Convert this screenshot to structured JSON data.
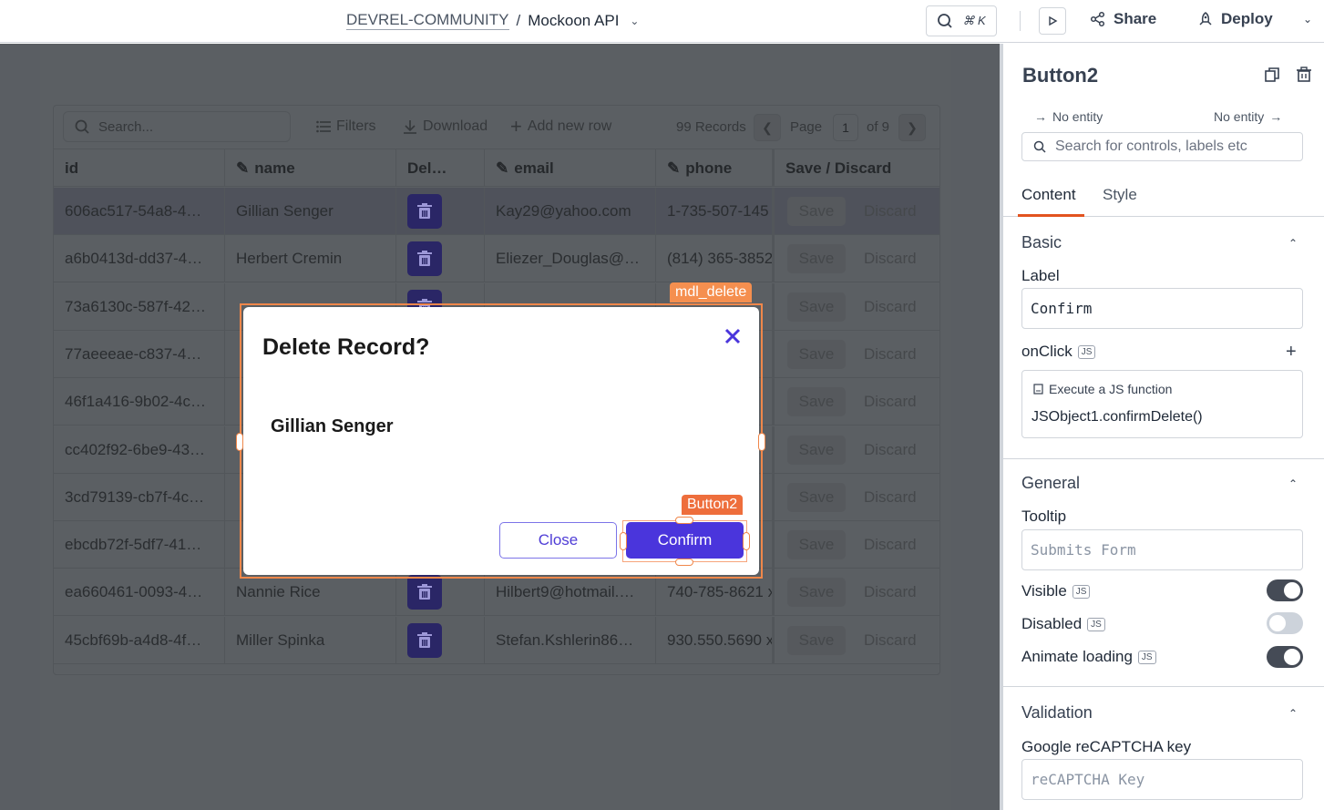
{
  "header": {
    "workspace": "DEVREL-COMMUNITY",
    "separator": "/",
    "app_name": "Mockoon API",
    "cmdk_shortcut": "⌘ K",
    "share_label": "Share",
    "deploy_label": "Deploy"
  },
  "table": {
    "search_placeholder": "Search...",
    "filters_label": "Filters",
    "download_label": "Download",
    "add_row_label": "Add new row",
    "records": "99 Records",
    "page_label": "Page",
    "page_current": "1",
    "page_of": "of 9",
    "columns": [
      "id",
      "name",
      "Del…",
      "email",
      "phone",
      "Save / Discard"
    ],
    "save_label": "Save",
    "discard_label": "Discard",
    "rows": [
      {
        "id": "606ac517-54a8-4…",
        "name": "Gillian Senger",
        "email": "Kay29@yahoo.com",
        "phone": "1-735-507-145",
        "selected": true
      },
      {
        "id": "a6b0413d-dd37-4…",
        "name": "Herbert Cremin",
        "email": "Eliezer_Douglas@…",
        "phone": "(814) 365-3852"
      },
      {
        "id": "73a6130c-587f-42…",
        "name": "",
        "email": "",
        "phone": ""
      },
      {
        "id": "77aeeeae-c837-4…",
        "name": "",
        "email": "",
        "phone": ""
      },
      {
        "id": "46f1a416-9b02-4c…",
        "name": "",
        "email": "",
        "phone": ""
      },
      {
        "id": "cc402f92-6be9-43…",
        "name": "",
        "email": "",
        "phone": ""
      },
      {
        "id": "3cd79139-cb7f-4c…",
        "name": "",
        "email": "",
        "phone": ""
      },
      {
        "id": "ebcdb72f-5df7-41…",
        "name": "",
        "email": "",
        "phone": ""
      },
      {
        "id": "ea660461-0093-4…",
        "name": "Nannie Rice",
        "email": "Hilbert9@hotmail.…",
        "phone": "740-785-8621 x"
      },
      {
        "id": "45cbf69b-a4d8-4f…",
        "name": "Miller Spinka",
        "email": "Stefan.Kshlerin86…",
        "phone": "930.550.5690 x"
      }
    ]
  },
  "modal": {
    "widget_tag": "mdl_delete",
    "title": "Delete Record?",
    "record_name": "Gillian Senger",
    "close_label": "Close",
    "confirm_label": "Confirm",
    "button_tag": "Button2"
  },
  "pane": {
    "widget_name": "Button2",
    "entity_left": "No entity",
    "entity_right": "No entity",
    "search_placeholder": "Search for controls, labels etc",
    "tabs": [
      "Content",
      "Style"
    ],
    "basic": {
      "title": "Basic",
      "label_label": "Label",
      "label_value": "Confirm",
      "onclick_label": "onClick",
      "js_badge": "JS",
      "onclick_action": "Execute a JS function",
      "onclick_fn": "JSObject1.confirmDelete()"
    },
    "general": {
      "title": "General",
      "tooltip_label": "Tooltip",
      "tooltip_placeholder": "Submits Form",
      "visible_label": "Visible",
      "visible": true,
      "disabled_label": "Disabled",
      "disabled": false,
      "animate_label": "Animate loading",
      "animate": true
    },
    "validation": {
      "title": "Validation",
      "recaptcha_label": "Google reCAPTCHA key",
      "recaptcha_placeholder": "reCAPTCHA Key"
    }
  },
  "colors": {
    "accent": "#4a35dc",
    "selection": "#f0874a",
    "tab_underline": "#e2531f"
  }
}
